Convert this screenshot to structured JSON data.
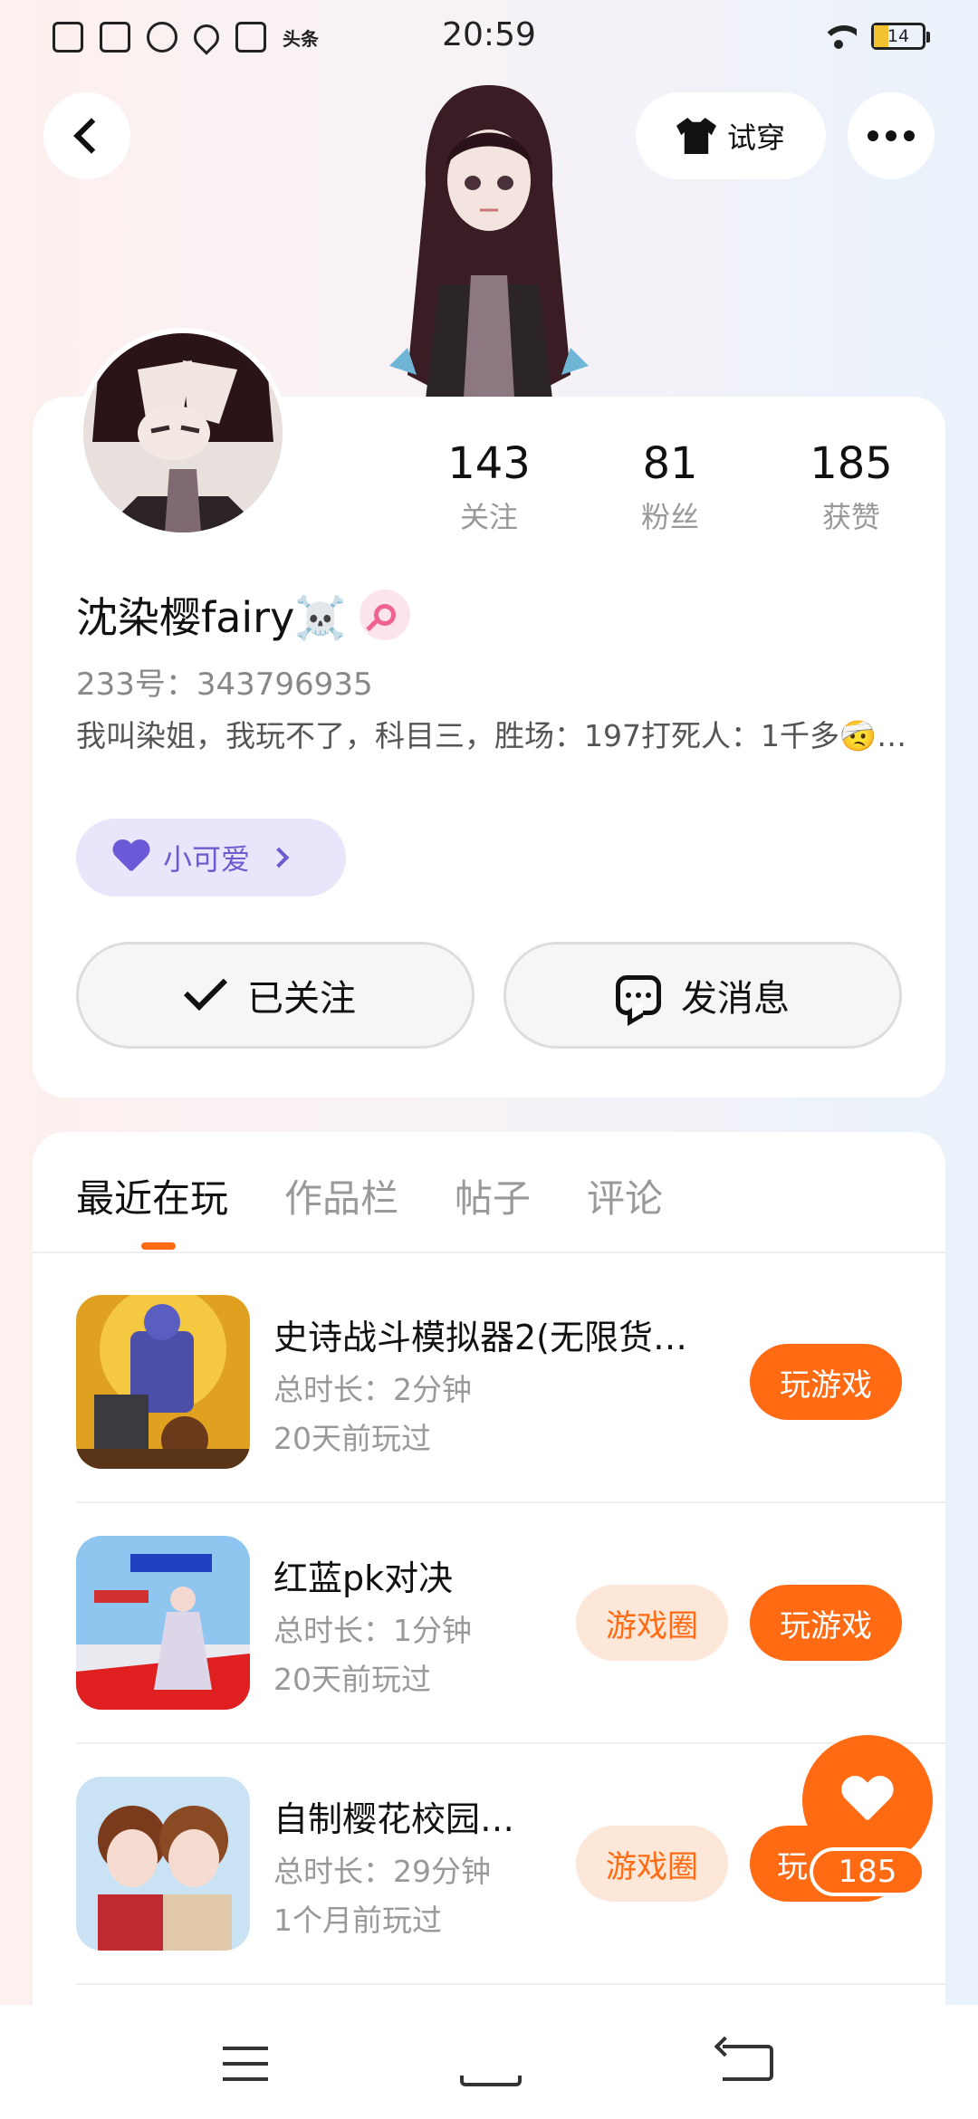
{
  "status_bar": {
    "time": "20:59",
    "battery": "14",
    "left_icons": [
      "sim-off-icon",
      "gamepad-icon",
      "controller-icon",
      "location-icon",
      "book-icon",
      "toutiao-icon"
    ],
    "toutiao_text": "头条",
    "battery_color": "#f2c230"
  },
  "header": {
    "tryon_label": "试穿"
  },
  "profile": {
    "username": "沈染樱fairy☠️",
    "uid_text": "233号：343796935",
    "bio": "我叫染姐，我玩不了，科目三，胜场：197打死人：1千多🤕…",
    "tag_label": "小可爱",
    "stats": [
      {
        "num": "143",
        "label": "关注"
      },
      {
        "num": "81",
        "label": "粉丝"
      },
      {
        "num": "185",
        "label": "获赞"
      }
    ],
    "follow_label": "已关注",
    "message_label": "发消息"
  },
  "tabs": [
    {
      "label": "最近在玩",
      "active": true
    },
    {
      "label": "作品栏",
      "active": false
    },
    {
      "label": "帖子",
      "active": false
    },
    {
      "label": "评论",
      "active": false
    }
  ],
  "games": [
    {
      "title": "史诗战斗模拟器2(无限货…",
      "duration": "总时长：2分钟",
      "last_played": "20天前玩过",
      "circle_label": "",
      "play_label": "玩游戏"
    },
    {
      "title": "红蓝pk对决",
      "duration": "总时长：1分钟",
      "last_played": "20天前玩过",
      "circle_label": "游戏圈",
      "play_label": "玩游戏"
    },
    {
      "title": "自制樱花校园…",
      "duration": "总时长：29分钟",
      "last_played": "1个月前玩过",
      "circle_label": "游戏圈",
      "play_label": "玩"
    }
  ],
  "fab": {
    "like_count": "185"
  },
  "colors": {
    "accent": "#ff6a13",
    "tag_bg": "#e9e5fb",
    "tag_text": "#6c5ccf"
  }
}
